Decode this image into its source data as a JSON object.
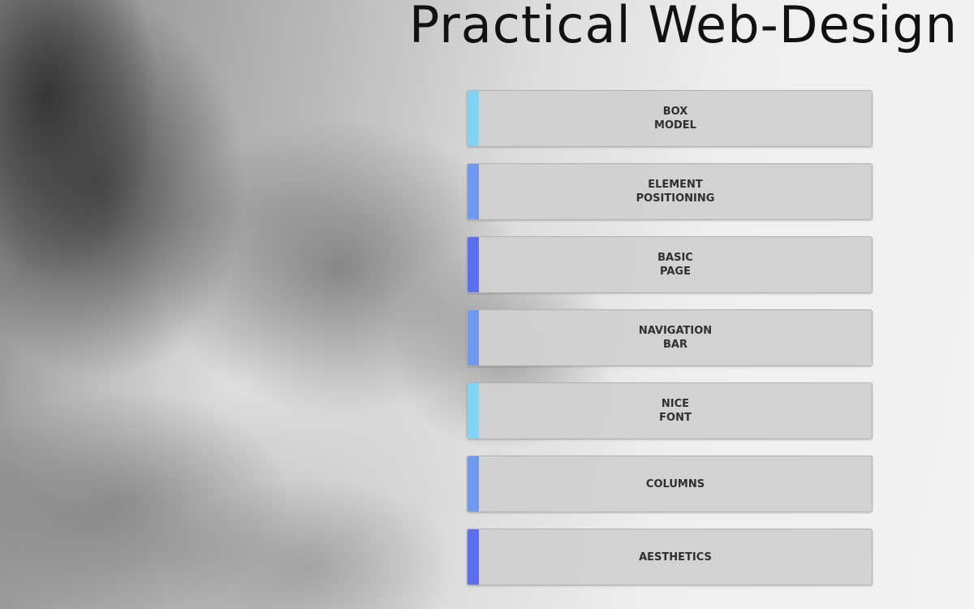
{
  "header": {
    "title": "Practical Web-Design"
  },
  "menu": {
    "items": [
      {
        "label": "BOX\nMODEL",
        "accent": "#7fd3f5"
      },
      {
        "label": "ELEMENT\nPOSITIONING",
        "accent": "#6f98f0"
      },
      {
        "label": "BASIC\nPAGE",
        "accent": "#5a6ff0"
      },
      {
        "label": "NAVIGATION\nBAR",
        "accent": "#6f98f0"
      },
      {
        "label": "NICE\nFONT",
        "accent": "#7fd3f5"
      },
      {
        "label": "COLUMNS",
        "accent": "#6f98f0"
      },
      {
        "label": "AESTHETICS",
        "accent": "#5a6ff0"
      }
    ]
  },
  "background": {
    "description_icon": "misty-mountain-photo"
  }
}
